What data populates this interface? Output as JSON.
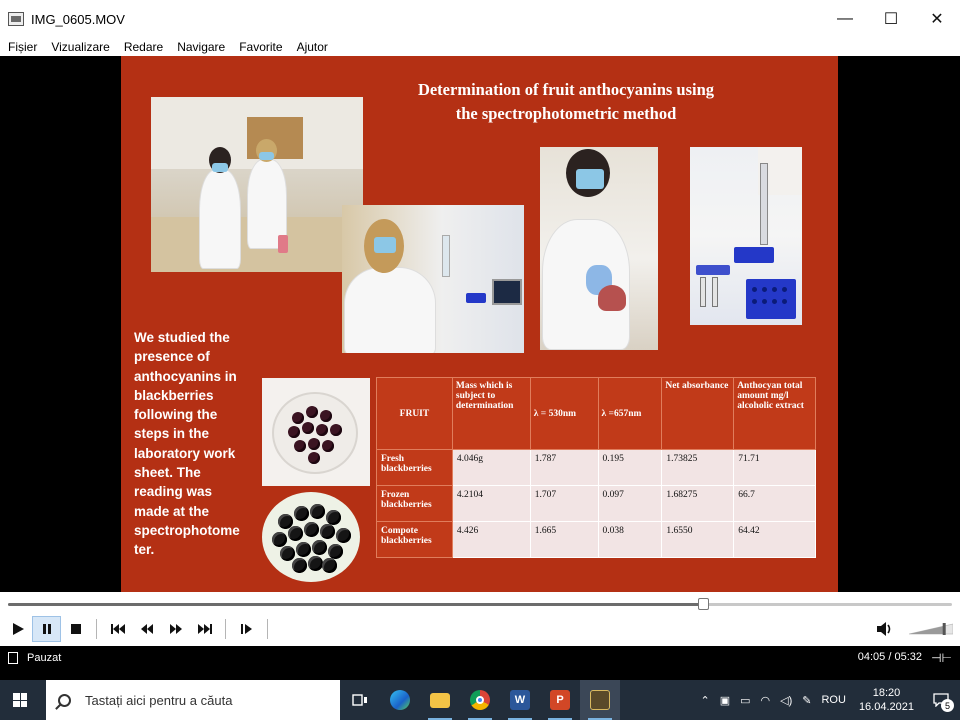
{
  "window": {
    "title": "IMG_0605.MOV",
    "icon": "video-file-icon",
    "controls": {
      "minimize": "—",
      "maximize": "☐",
      "close": "✕"
    }
  },
  "menu": [
    "Fișier",
    "Vizualizare",
    "Redare",
    "Navigare",
    "Favorite",
    "Ajutor"
  ],
  "slide": {
    "title_line1": "Determination of fruit anthocyanins using",
    "title_line2": "the spectrophotometric method",
    "body_text": "We studied the presence of anthocyanins in blackberries following the steps in the laboratory work sheet. The reading was made at the spectrophotome ter.",
    "background": "#b43014",
    "table": {
      "headers": [
        "FRUIT",
        "Mass which is subject to determination",
        "λ =  530nm",
        "λ =657nm",
        "Net absorbance",
        "Anthocyan total amount mg/l alcoholic extract"
      ],
      "rows": [
        [
          "Fresh blackberries",
          "4.046g",
          "1.787",
          "0.195",
          "1.73825",
          "71.71"
        ],
        [
          "Frozen blackberries",
          "4.2104",
          "1.707",
          "0.097",
          "1.68275",
          "66.7"
        ],
        [
          "Compote blackberries",
          "4.426",
          "1.665",
          "0.038",
          "1.6550",
          "64.42"
        ]
      ]
    }
  },
  "playback": {
    "progress": 0.736,
    "controls": [
      "play",
      "pause",
      "stop",
      "previous",
      "rewind",
      "fast-forward",
      "next",
      "frame-step"
    ],
    "state_label": "Pauzat",
    "time_label": "04:05 / 05:32",
    "volume": 0.8
  },
  "taskbar": {
    "search_placeholder": "Tastați aici pentru a căuta",
    "apps": [
      "task-view",
      "edge",
      "file-explorer",
      "chrome",
      "word",
      "powerpoint",
      "media-player"
    ],
    "tray": {
      "language": "ROU",
      "time": "18:20",
      "date": "16.04.2021",
      "notifications": "5"
    }
  }
}
